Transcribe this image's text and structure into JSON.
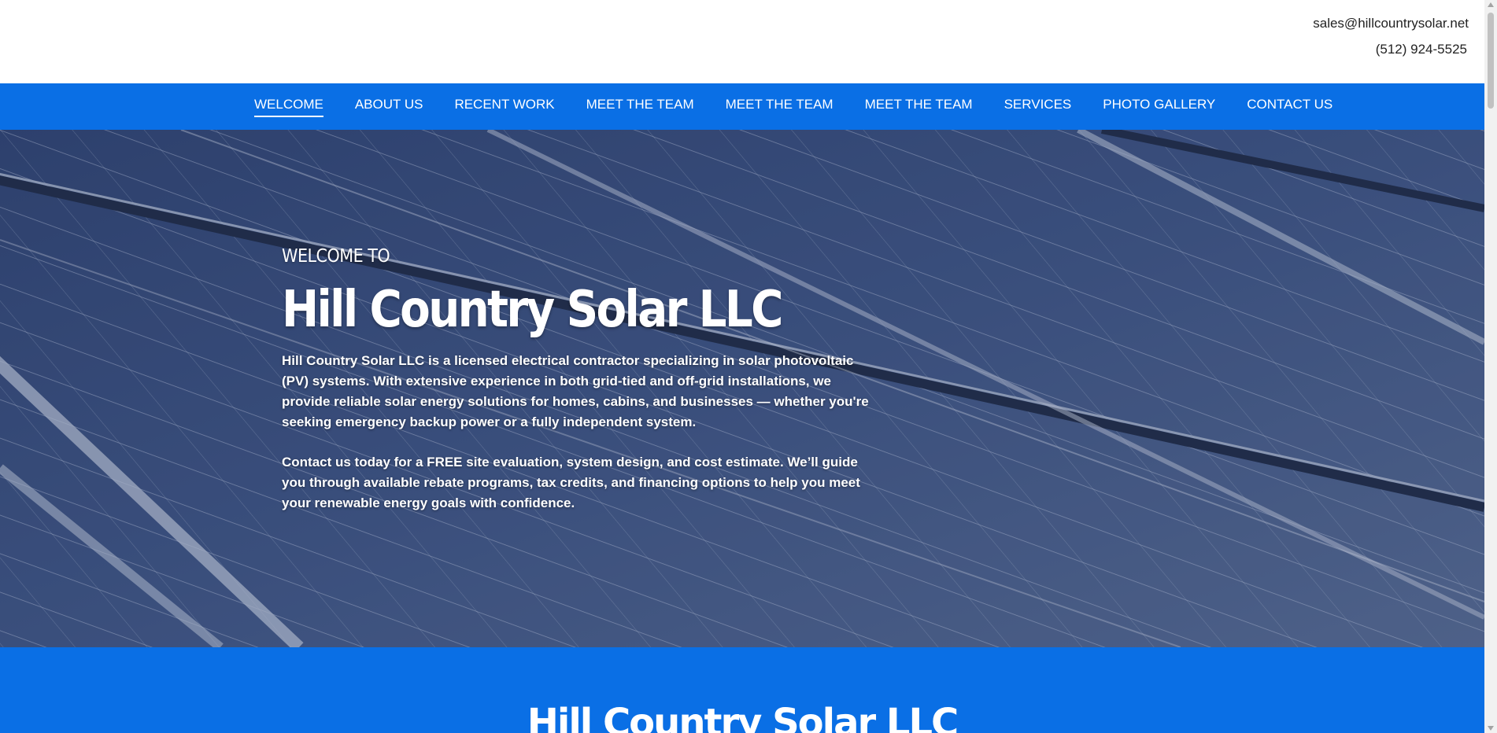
{
  "header": {
    "email": "sales@hillcountrysolar.net",
    "phone": "(512) 924-5525"
  },
  "nav": {
    "items": [
      {
        "label": "WELCOME",
        "active": true
      },
      {
        "label": "ABOUT US"
      },
      {
        "label": "RECENT WORK"
      },
      {
        "label": "MEET THE TEAM"
      },
      {
        "label": "MEET THE TEAM"
      },
      {
        "label": "MEET THE TEAM"
      },
      {
        "label": "SERVICES"
      },
      {
        "label": "PHOTO GALLERY"
      },
      {
        "label": "CONTACT US"
      }
    ]
  },
  "hero": {
    "kicker": "WELCOME TO",
    "title": "Hill Country Solar LLC",
    "paragraph1": "Hill Country Solar LLC is a licensed electrical contractor specializing in solar photovoltaic (PV) systems. With extensive experience in both grid-tied and off-grid installations, we provide reliable solar energy solutions for homes, cabins, and businesses — whether you're seeking emergency backup power or a fully independent system.",
    "paragraph2": "Contact us today for a FREE site evaluation, system design, and cost estimate. We’ll guide you through available rebate programs, tax credits, and financing options to help you meet your renewable energy goals with confidence."
  },
  "section2": {
    "title": "Hill Country Solar LLC"
  },
  "colors": {
    "brand_blue": "#0a6fe5",
    "hero_overlay": "#465a82",
    "text_white": "#ffffff"
  },
  "icons": {
    "scroll_up": "scroll-up-arrow-icon",
    "scroll_down": "scroll-down-arrow-icon"
  }
}
